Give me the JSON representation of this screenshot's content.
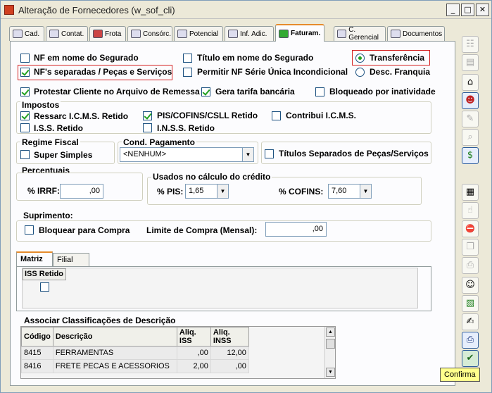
{
  "window": {
    "title": "Alteração de Fornecedores (w_sof_cli)",
    "min": "_",
    "max": "□",
    "close": "✕"
  },
  "tabs": [
    {
      "label": "Cad.",
      "icon": "card-icon"
    },
    {
      "label": "Contat.",
      "icon": "phone-icon"
    },
    {
      "label": "Frota",
      "icon": "truck-icon"
    },
    {
      "label": "Consórc.",
      "icon": "money-icon"
    },
    {
      "label": "Potencial",
      "icon": "calendar-icon"
    },
    {
      "label": "Inf. Adic.",
      "icon": "list-icon"
    },
    {
      "label": "Faturam.",
      "icon": "money-bag-icon"
    },
    {
      "label": "C. Gerencial",
      "icon": "grid-icon"
    },
    {
      "label": "Documentos",
      "icon": "document-icon"
    }
  ],
  "fat": {
    "nf_segurado": "NF em nome do Segurado",
    "nf_separadas": "NF's separadas / Peças e Serviços",
    "titulo_segurado": "Título em nome do Segurado",
    "permitir_nf": "Permitir NF Série Única Incondicional",
    "transferencia": "Transferência",
    "desc_franquia": "Desc. Franquia",
    "protestar": "Protestar Cliente no Arquivo de Remessa",
    "gera_tarifa": "Gera tarifa bancária",
    "bloqueado": "Bloqueado por inatividade"
  },
  "impostos": {
    "title": "Impostos",
    "ressarc": "Ressarc I.C.M.S. Retido",
    "pis_cofins": "PIS/COFINS/CSLL Retido",
    "contribui": "Contribui I.C.M.S.",
    "iss": "I.S.S. Retido",
    "inss": "I.N.S.S. Retido"
  },
  "regime": {
    "title": "Regime Fiscal",
    "super_simples": "Super Simples"
  },
  "cond": {
    "title": "Cond. Pagamento",
    "value": "<NENHUM>"
  },
  "titulos_sep": "Títulos Separados de Peças/Serviços",
  "percentuais": {
    "title": "Percentuais",
    "irrf_label": "% IRRF:",
    "irrf_value": ",00"
  },
  "usados": {
    "title": "Usados no cálculo do crédito",
    "pis_label": "% PIS:",
    "pis_value": "1,65",
    "cofins_label": "% COFINS:",
    "cofins_value": "7,60"
  },
  "suprimento": {
    "title": "Suprimento:",
    "bloquear": "Bloquear para Compra",
    "limite_label": "Limite de Compra (Mensal):",
    "limite_value": ",00"
  },
  "subtabs": {
    "matriz": "Matriz",
    "filial": "Filial"
  },
  "iss_col": "ISS Retido",
  "assoc": {
    "title": "Associar Classificações de Descrição",
    "headers": [
      "Código",
      "Descrição",
      "Aliq. ISS",
      "Aliq. INSS"
    ],
    "rows": [
      [
        "8415",
        "FERRAMENTAS",
        ",00",
        "12,00"
      ],
      [
        "8416",
        "FRETE PECAS E ACESSORIOS",
        "2,00",
        ",00"
      ]
    ]
  },
  "toolbar": [
    {
      "name": "tree-icon",
      "glyph": "☷",
      "state": "disabled"
    },
    {
      "name": "table-icon",
      "glyph": "▤",
      "state": "disabled"
    },
    {
      "name": "house-icon",
      "glyph": "⌂",
      "state": "normal"
    },
    {
      "name": "user-icon",
      "glyph": "☻",
      "state": "active"
    },
    {
      "name": "tag-icon",
      "glyph": "✎",
      "state": "disabled"
    },
    {
      "name": "search-doc-icon",
      "glyph": "⌕",
      "state": "disabled"
    },
    {
      "name": "money-bag-icon",
      "glyph": "$",
      "state": "active"
    },
    {
      "name": "report-icon",
      "glyph": "▦",
      "state": "normal"
    },
    {
      "name": "thumb-icon",
      "glyph": "☝",
      "state": "disabled"
    },
    {
      "name": "stop-icon",
      "glyph": "⛔",
      "state": "disabled"
    },
    {
      "name": "copy-icon",
      "glyph": "❐",
      "state": "disabled"
    },
    {
      "name": "print-icon",
      "glyph": "⎙",
      "state": "disabled"
    },
    {
      "name": "users-icon",
      "glyph": "☺",
      "state": "normal"
    },
    {
      "name": "clipboard-icon",
      "glyph": "▧",
      "state": "normal"
    },
    {
      "name": "note-icon",
      "glyph": "✍",
      "state": "normal"
    },
    {
      "name": "printer-icon",
      "glyph": "⎙",
      "state": "normal"
    },
    {
      "name": "confirm-icon",
      "glyph": "✔",
      "state": "active"
    }
  ],
  "tooltip": "Confirma"
}
